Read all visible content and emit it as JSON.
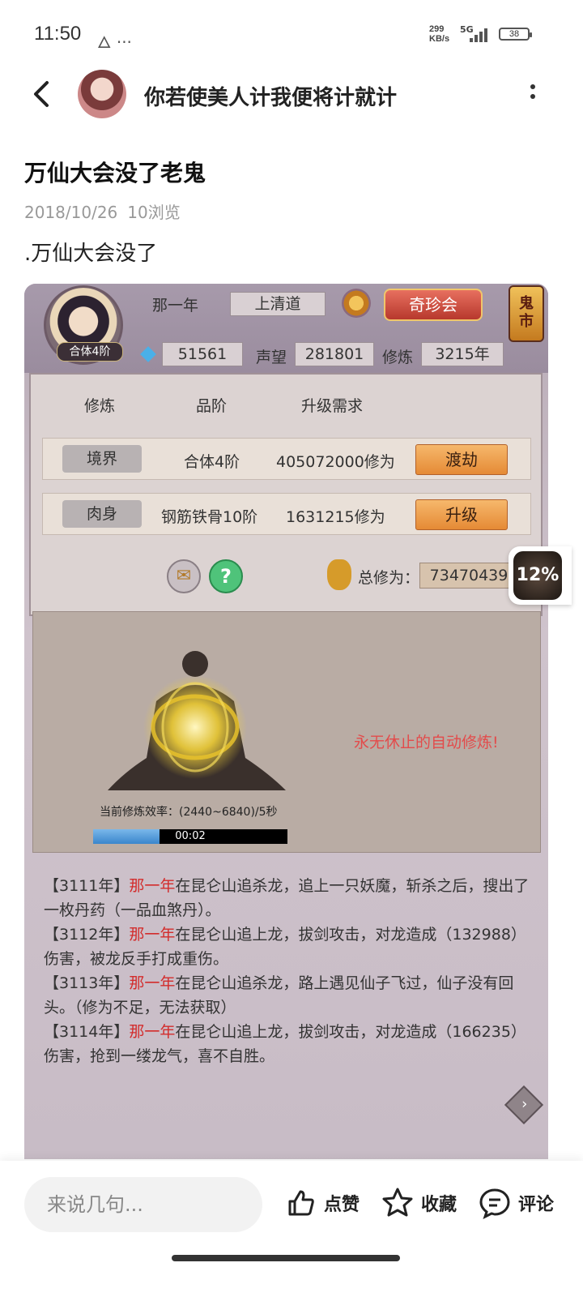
{
  "status_bar": {
    "time": "11:50",
    "icons": "🜂 ···",
    "net_speed_value": "299",
    "net_speed_unit": "KB/s",
    "network": "5G",
    "battery": "38"
  },
  "header": {
    "title": "你若使美人计我便将计就计"
  },
  "post": {
    "title": "万仙大会没了老鬼",
    "date": "2018/10/26",
    "views": "10浏览",
    "body": ".万仙大会没了"
  },
  "game": {
    "player_name": "那一年",
    "sect": "上清道",
    "rank_tag": "合体4阶",
    "qizhen_label": "奇珍会",
    "guishi_label": "鬼\n市",
    "gems": "51561",
    "reputation_label": "声望",
    "reputation": "281801",
    "cultivation_label": "修炼",
    "cultivation_years": "3215年",
    "col_headers": [
      "修炼",
      "品阶",
      "升级需求"
    ],
    "rows": [
      {
        "tag": "境界",
        "grade": "合体4阶",
        "requirement": "405072000修为",
        "button": "渡劫"
      },
      {
        "tag": "肉身",
        "grade": "钢筋铁骨10阶",
        "requirement": "1631215修为",
        "button": "升级"
      }
    ],
    "total_label": "总修为：",
    "total_value": "73470439",
    "auto_text": "永无休止的自动修炼!",
    "efficiency_text": "当前修炼效率：(2440~6840)/5秒",
    "progress_fraction": 0.34,
    "progress_time": "00:02",
    "log": [
      {
        "year": "【3111年】",
        "name": "那一年",
        "text": "在昆仑山追杀龙，追上一只妖魔，斩杀之后，搜出了一枚丹药（一品血煞丹）。"
      },
      {
        "year": "【3112年】",
        "name": "那一年",
        "text": "在昆仑山追上龙，拔剑攻击，对龙造成（132988）伤害，被龙反手打成重伤。"
      },
      {
        "year": "【3113年】",
        "name": "那一年",
        "text": "在昆仑山追杀龙，路上遇见仙子飞过，仙子没有回头。（修为不足，无法获取）"
      },
      {
        "year": "【3114年】",
        "name": "那一年",
        "text": "在昆仑山追上龙，拔剑攻击，对龙造成（166235）伤害，抢到一缕龙气，喜不自胜。"
      }
    ]
  },
  "floating_badge": "12%",
  "bottom_bar": {
    "comment_placeholder": "来说几句...",
    "like": "点赞",
    "favorite": "收藏",
    "comment": "评论"
  }
}
